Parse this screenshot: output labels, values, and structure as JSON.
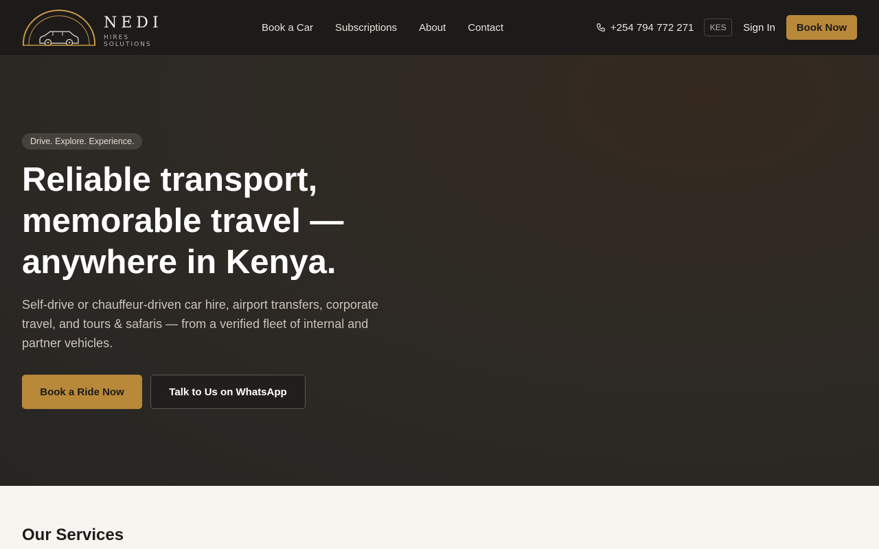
{
  "brand": {
    "name": "NEDI",
    "subtitle": "HIRES SOLUTIONS",
    "accent_color": "#b9893a",
    "logo_icon": "car-arch-logo"
  },
  "nav": {
    "items": [
      {
        "label": "Book a Car"
      },
      {
        "label": "Subscriptions"
      },
      {
        "label": "About"
      },
      {
        "label": "Contact"
      }
    ]
  },
  "header": {
    "phone": "+254 794 772 271",
    "phone_icon": "phone-icon",
    "currency": "KES",
    "sign_in": "Sign In",
    "book_now": "Book Now"
  },
  "hero": {
    "tagline": "Drive. Explore. Experience.",
    "title": "Reliable transport, memorable travel — anywhere in Kenya.",
    "description": "Self-drive or chauffeur-driven car hire, airport transfers, corporate travel, and tours & safaris — from a verified fleet of internal and partner vehicles.",
    "primary_cta": "Book a Ride Now",
    "secondary_cta": "Talk to Us on WhatsApp"
  },
  "services": {
    "title": "Our Services"
  }
}
